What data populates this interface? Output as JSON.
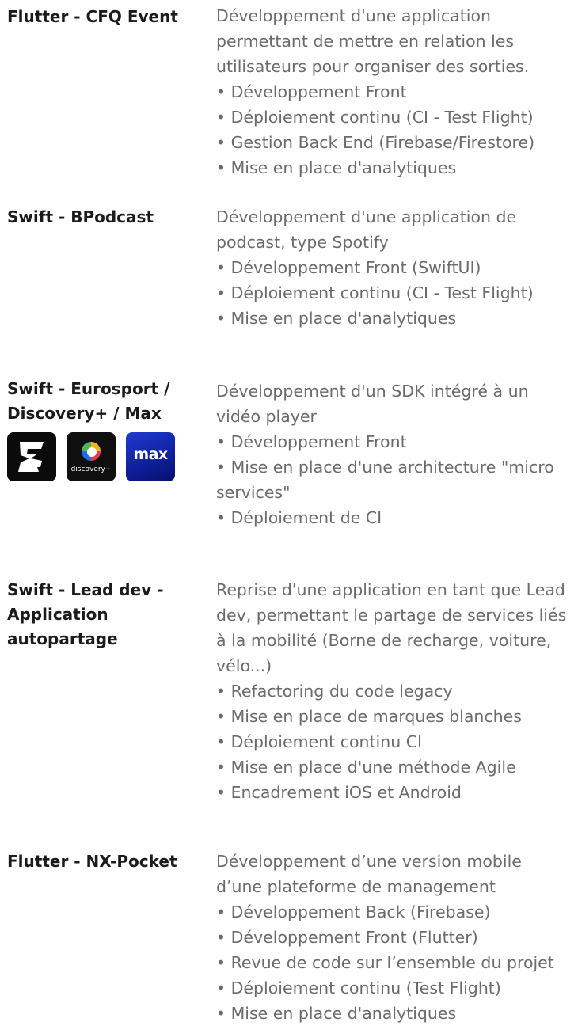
{
  "projects": [
    {
      "title_lines": [
        "Flutter - CFQ Event"
      ],
      "desc_lines": [
        "Développement d'une application",
        "permettant de mettre en relation les",
        "utilisateurs pour organiser des sorties.",
        "• Développement Front",
        "• Déploiement continu (CI - Test Flight)",
        "• Gestion Back End (Firebase/Firestore)",
        "• Mise en place d'analytiques"
      ]
    },
    {
      "title_lines": [
        "Swift - BPodcast"
      ],
      "desc_lines": [
        "Développement d'une application de",
        "podcast, type Spotify",
        "• Développement Front (SwiftUI)",
        "• Déploiement continu (CI - Test Flight)",
        "• Mise en place d'analytiques"
      ]
    },
    {
      "title_lines": [
        "Swift - Eurosport /",
        "Discovery+ / Max"
      ],
      "logos": {
        "eurosport": "eurosport-logo",
        "discovery": "discovery+",
        "max": "max"
      },
      "desc_lines": [
        "Développement d'un SDK intégré à un",
        "vidéo player",
        "• Développement Front",
        "• Mise en place d'une architecture \"micro",
        "services\"",
        "• Déploiement de CI"
      ]
    },
    {
      "title_lines": [
        "Swift - Lead dev -",
        "Application",
        "autopartage"
      ],
      "desc_lines": [
        "Reprise d'une application en tant que Lead",
        "dev, permettant le partage de services liés",
        "à la mobilité (Borne de recharge, voiture,",
        "vélo...)",
        "• Refactoring du code legacy",
        "• Mise en place de marques blanches",
        "• Déploiement continu CI",
        "• Mise en place d'une méthode Agile",
        "• Encadrement iOS et Android"
      ]
    },
    {
      "title_lines": [
        "Flutter - NX-Pocket"
      ],
      "desc_lines": [
        "Développement d’une version mobile",
        "d’une plateforme de management",
        "• Développement Back (Firebase)",
        "• Développement Front (Flutter)",
        "• Revue de code sur l’ensemble du projet",
        "• Déploiement continu (Test Flight)",
        "• Mise en place d'analytiques"
      ]
    }
  ],
  "colors": {
    "title": "#1b1b1b",
    "text": "#6b6b6b",
    "max_blue": "#1f3bd1"
  }
}
